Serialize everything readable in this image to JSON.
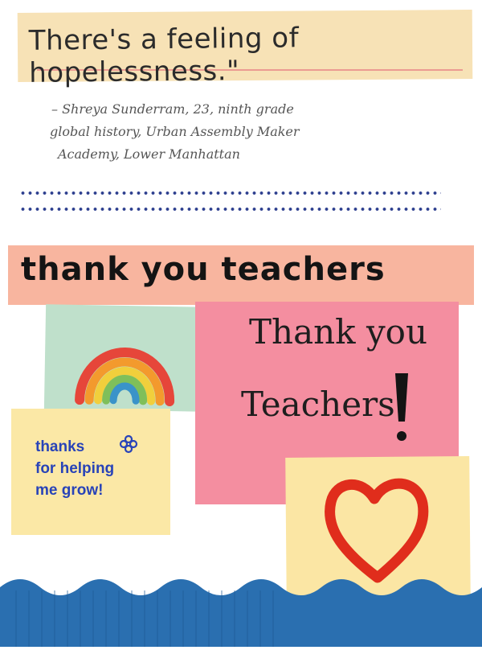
{
  "quote": {
    "text": "There's a feeling of hopelessness.\"",
    "attribution_lines": [
      "– Shreya Sunderram, 23, ninth grade",
      "global history, Urban Assembly Maker",
      "Academy, Lower Manhattan"
    ]
  },
  "banner": {
    "text": "thank you teachers"
  },
  "pink_card": {
    "line1": "Thank you",
    "line2": "Teachers"
  },
  "yellow_note": {
    "lines": [
      "thanks",
      "for helping",
      "me grow!"
    ]
  },
  "icons": {
    "rainbow": "rainbow-icon",
    "flower": "flower-icon",
    "exclamation": "exclamation-icon",
    "heart": "heart-icon"
  },
  "colors": {
    "quote_bg": "#f7e2b6",
    "banner_bg": "#f8b59f",
    "pink_card": "#f48ea0",
    "rainbow_card": "#bfe0cb",
    "yellow_note": "#fbe8a6",
    "heart": "#e02d1c",
    "wave": "#2a6fb0"
  }
}
